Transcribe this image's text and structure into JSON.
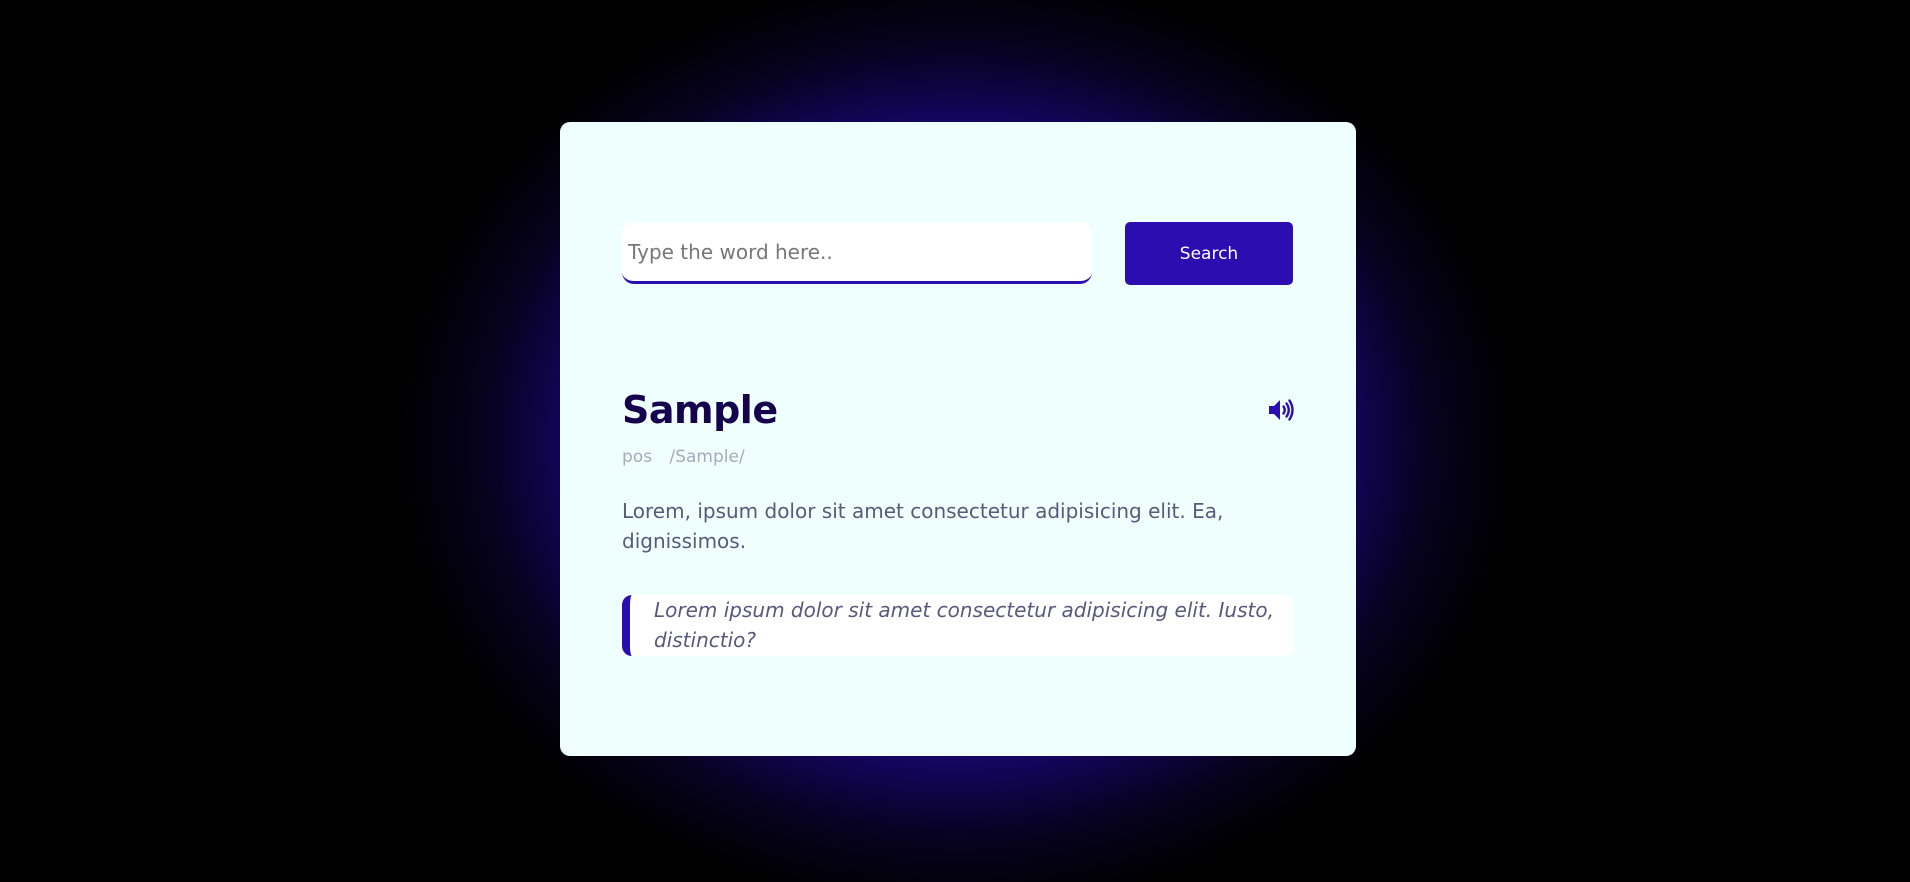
{
  "search": {
    "placeholder": "Type the word here..",
    "value": "",
    "button_label": "Search"
  },
  "result": {
    "word": "Sample",
    "part_of_speech": "pos",
    "phonetic": "/Sample/",
    "definition": "Lorem, ipsum dolor sit amet consectetur adipisicing elit. Ea, dignissimos.",
    "example": "Lorem ipsum dolor sit amet consectetur adipisicing elit. Iusto, distinctio?",
    "audio_icon": "volume-up-icon"
  },
  "colors": {
    "accent": "#2c0db0",
    "card_background": "#effffd",
    "word_color": "#15034d",
    "muted_text": "#a7a9be",
    "body_text": "#575a7b"
  }
}
